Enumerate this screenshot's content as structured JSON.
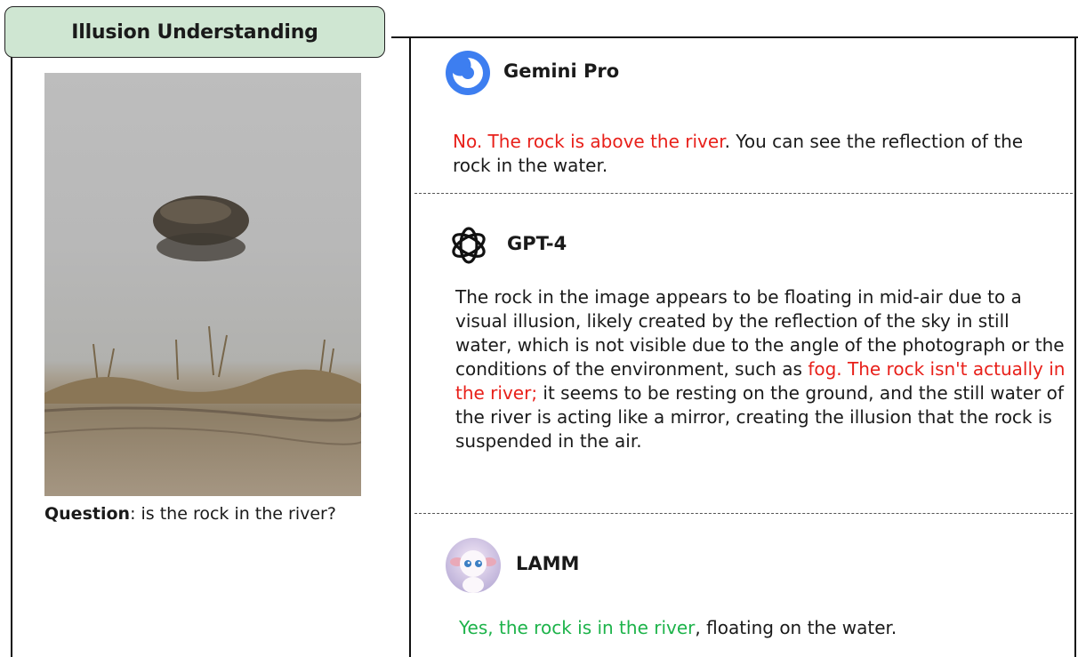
{
  "panel": {
    "title": "Illusion Understanding"
  },
  "question": {
    "label": "Question",
    "text": ": is the rock in the river?"
  },
  "models": [
    {
      "name": "Gemini Pro",
      "icon": "gemini-icon",
      "response": {
        "highlight": "No. The rock is above the river",
        "rest": ". You can see the reflection of the rock in the water."
      }
    },
    {
      "name": "GPT-4",
      "icon": "openai-icon",
      "response": {
        "before": "The rock in the image appears to be floating in mid-air due to a visual illusion, likely created by the reflection of the sky in still water, which is not visible due to the angle of the photograph or the conditions of the environment, such as ",
        "highlight": "fog. The rock isn't actually in the river;",
        "after": " it seems to be resting on the ground, and the still water of the river is acting like a mirror, creating the illusion that the rock is suspended in the air."
      }
    },
    {
      "name": "LAMM",
      "icon": "lamb-avatar-icon",
      "response": {
        "highlight": "Yes, the rock is in the river",
        "rest": ", floating on the water."
      }
    }
  ],
  "colors": {
    "wrong": "#e8201a",
    "right": "#1db34a",
    "tab": "#cfe6d2"
  }
}
